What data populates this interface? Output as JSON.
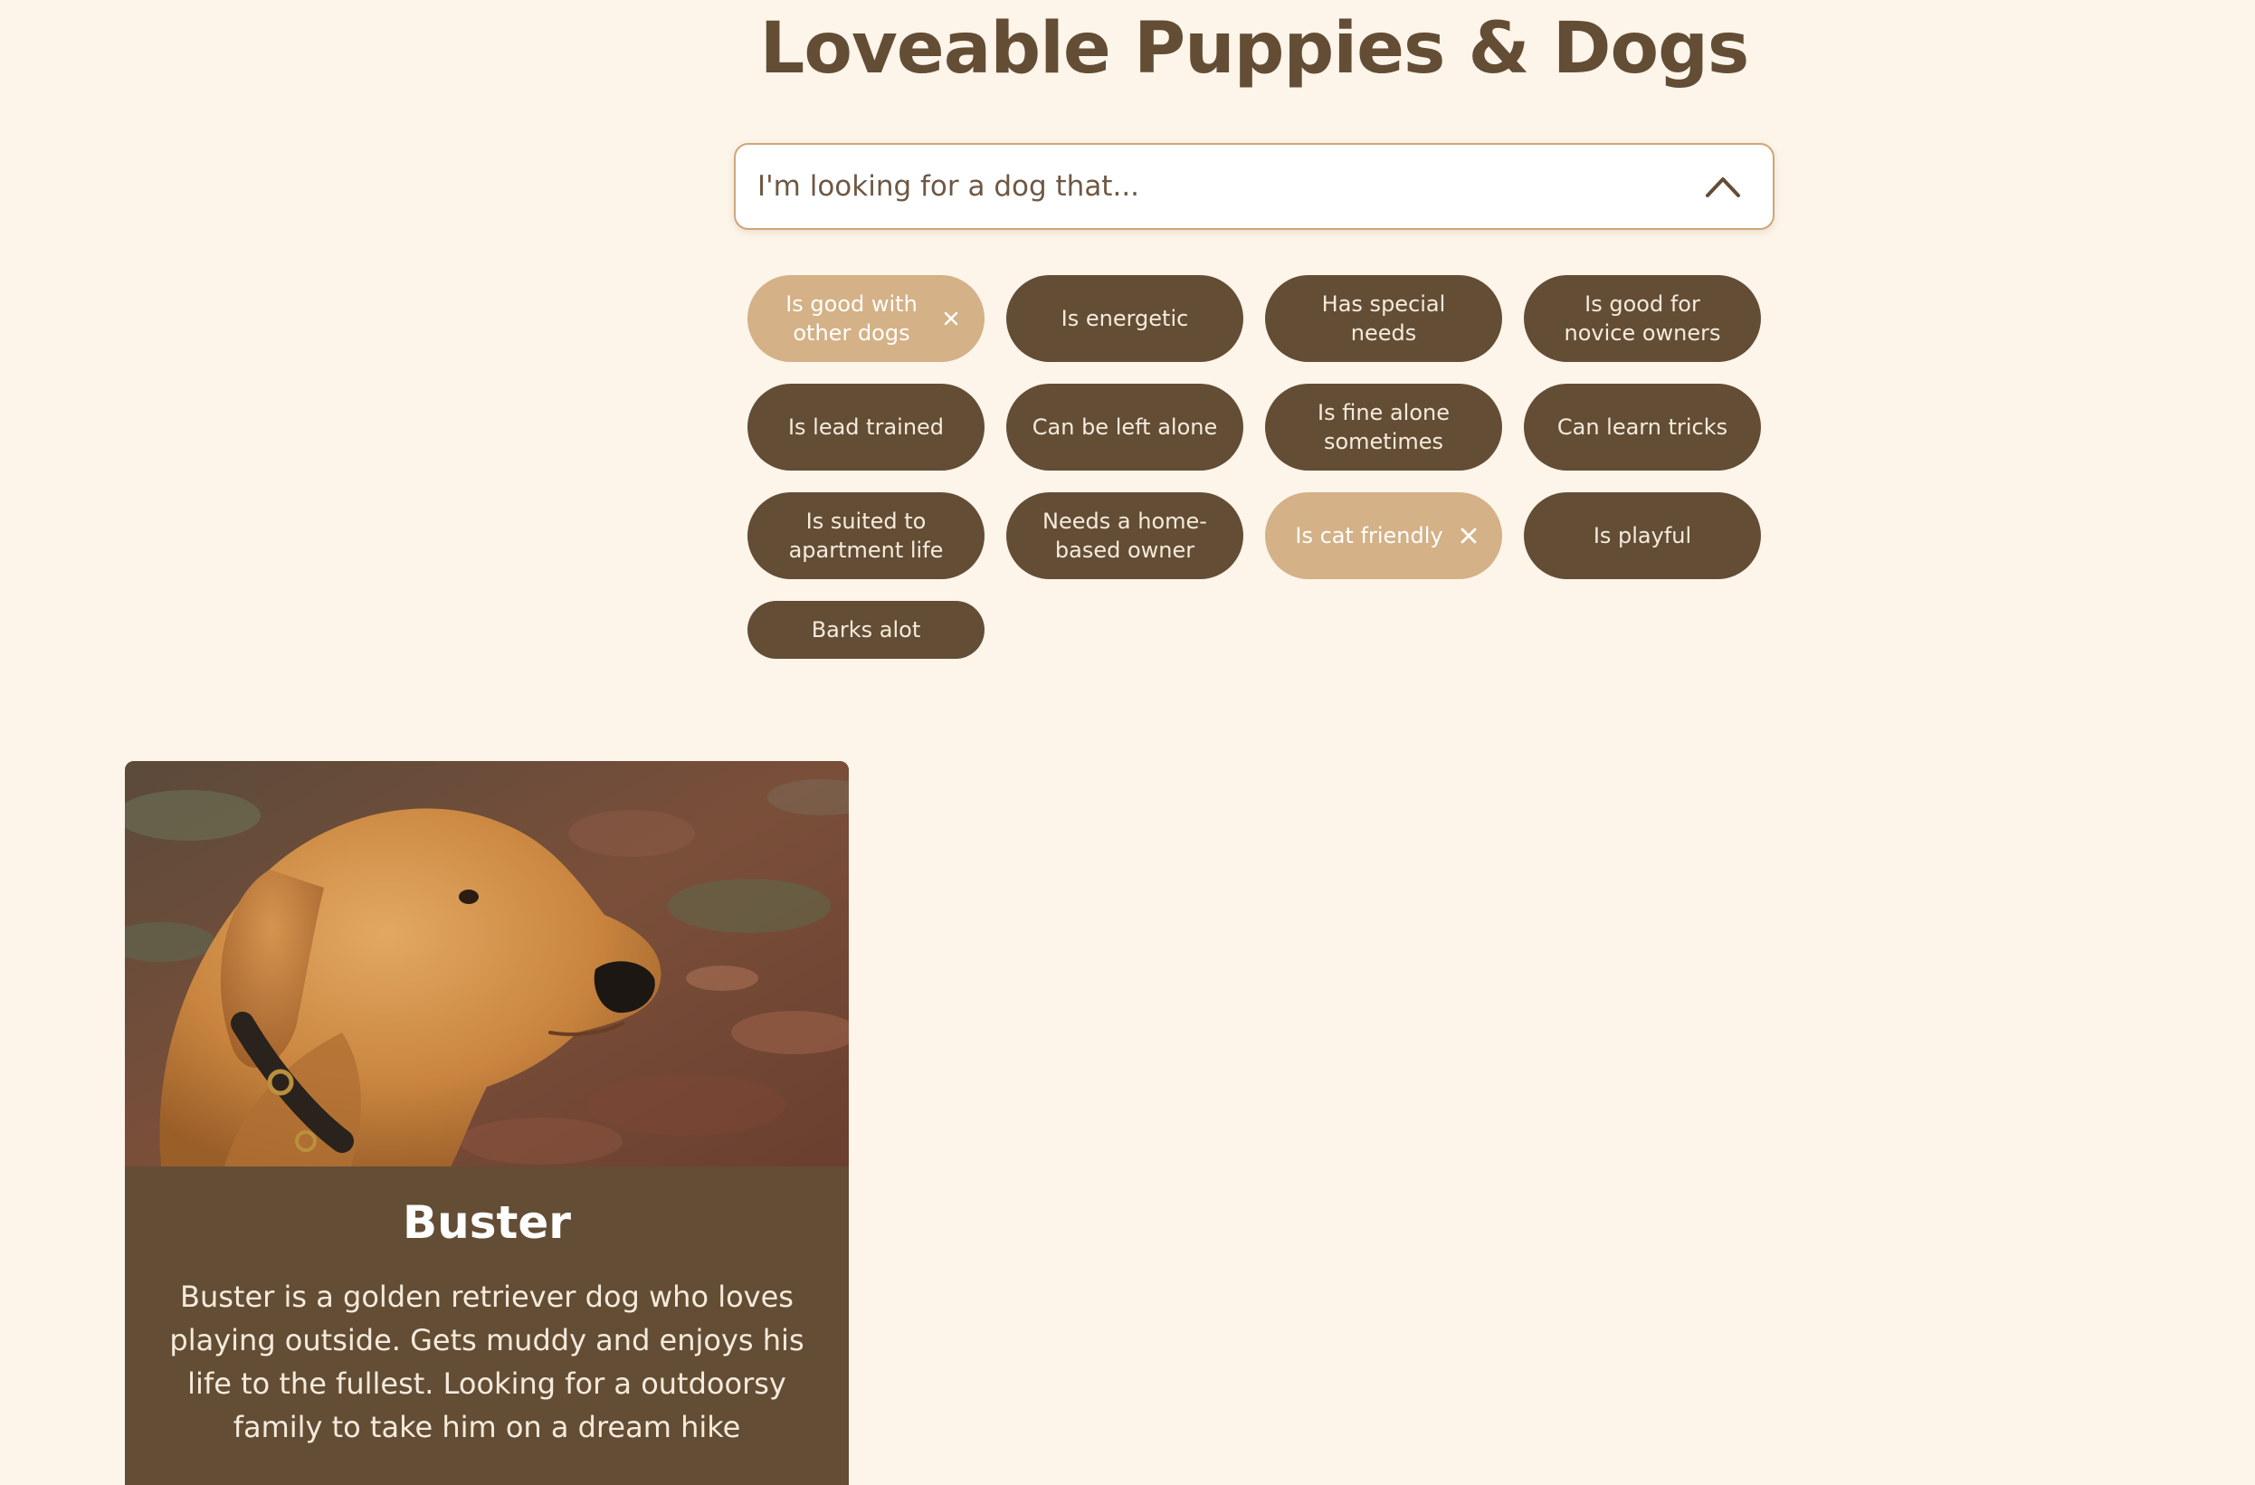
{
  "page": {
    "title": "Loveable Puppies & Dogs"
  },
  "search": {
    "placeholder": "I'm looking for a dog that...",
    "toggle_icon": "chevron-up-icon"
  },
  "filters": [
    {
      "label": "Is good with other dogs",
      "selected": true
    },
    {
      "label": "Is energetic",
      "selected": false
    },
    {
      "label": "Has special needs",
      "selected": false
    },
    {
      "label": "Is good for novice owners",
      "selected": false
    },
    {
      "label": "Is lead trained",
      "selected": false
    },
    {
      "label": "Can be left alone",
      "selected": false
    },
    {
      "label": "Is fine alone sometimes",
      "selected": false
    },
    {
      "label": "Can learn tricks",
      "selected": false
    },
    {
      "label": "Is suited to apartment life",
      "selected": false
    },
    {
      "label": "Needs a home-based owner",
      "selected": false
    },
    {
      "label": "Is cat friendly",
      "selected": true
    },
    {
      "label": "Is playful",
      "selected": false
    },
    {
      "label": "Barks alot",
      "selected": false
    }
  ],
  "dogs": [
    {
      "name": "Buster",
      "description": "Buster is a golden retriever dog who loves playing outside. Gets muddy and enjoys his life to the fullest. Looking for a outdoorsy family to take him on a dream hike"
    }
  ],
  "colors": {
    "background": "#fdf5ea",
    "primary_brown": "#644d35",
    "chip_selected": "#d4b186",
    "search_border": "#cda67a"
  }
}
